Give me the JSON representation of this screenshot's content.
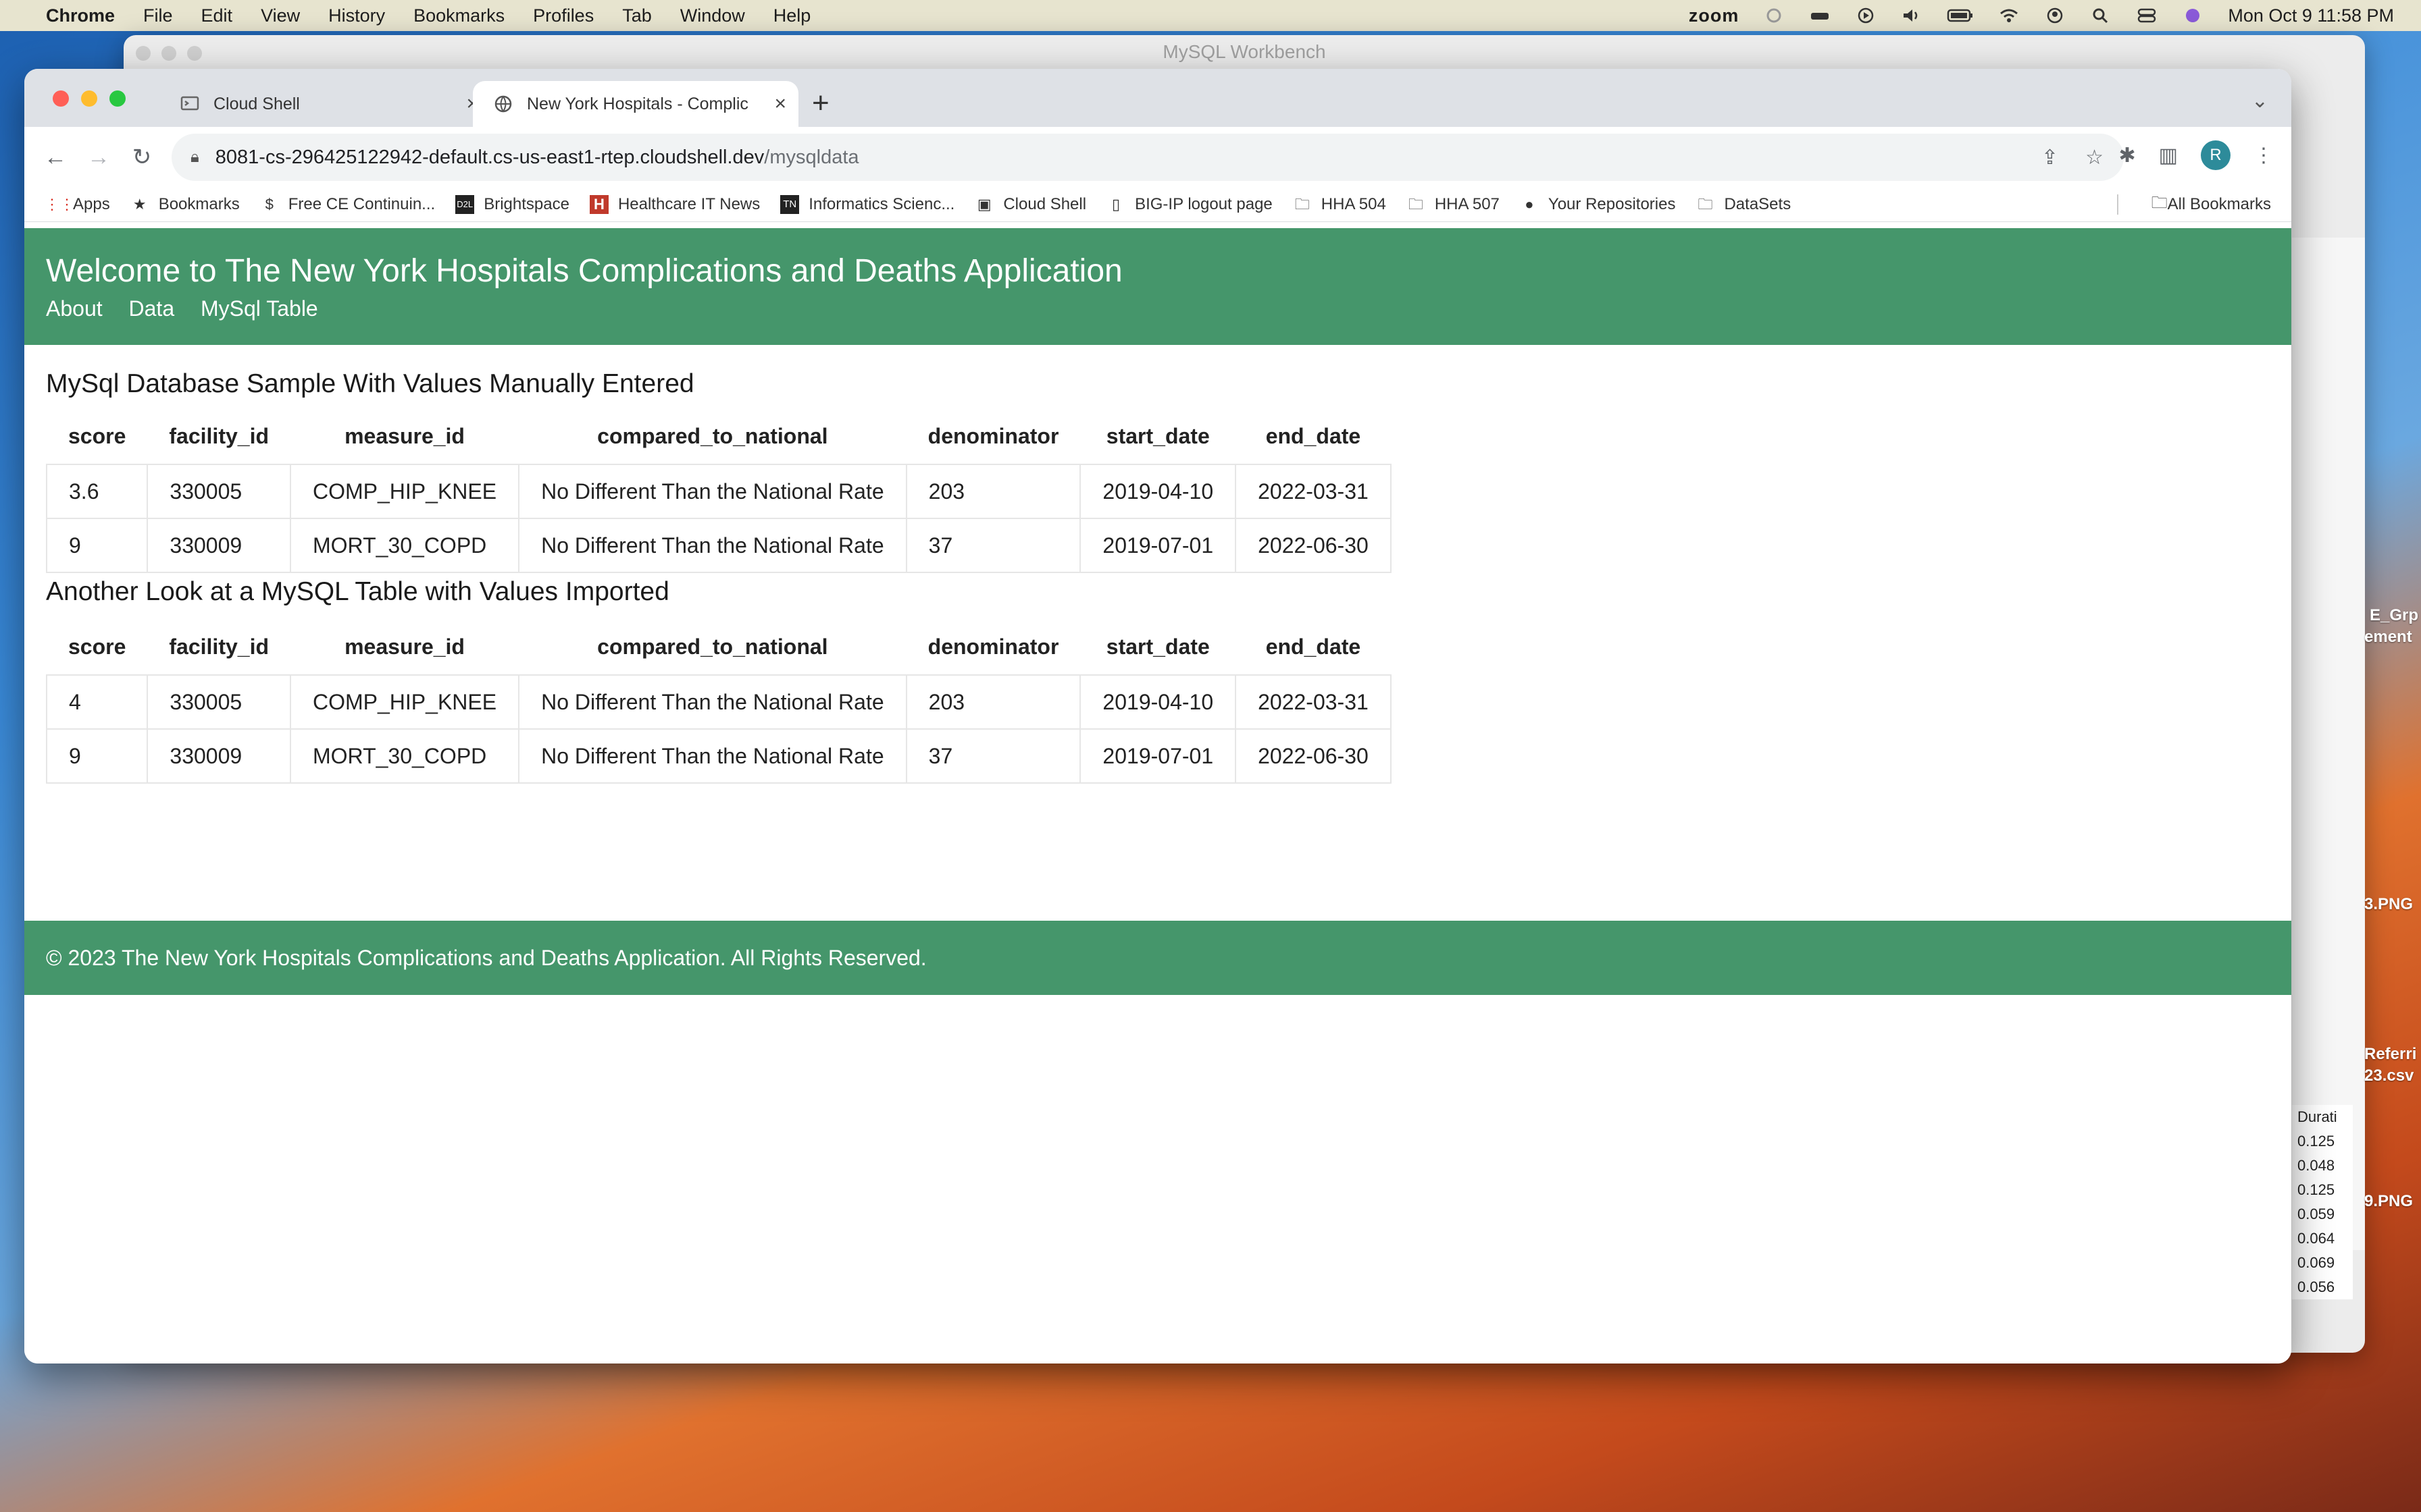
{
  "menubar": {
    "app": "Chrome",
    "items": [
      "File",
      "Edit",
      "View",
      "History",
      "Bookmarks",
      "Profiles",
      "Tab",
      "Window",
      "Help"
    ],
    "zoom_label": "zoom",
    "datetime": "Mon Oct 9  11:58 PM"
  },
  "bg_window": {
    "title": "MySQL Workbench",
    "duration_header": "Durati",
    "durations": [
      "0.125",
      "0.048",
      "0.125",
      "0.059",
      "0.064",
      "0.069",
      "0.056"
    ]
  },
  "desktop_labels": [
    "E_Grp",
    "ement",
    "3.PNG",
    "Referri",
    "23.csv",
    "9.PNG"
  ],
  "tabs": [
    {
      "label": "Cloud Shell"
    },
    {
      "label": "New York Hospitals - Complic"
    }
  ],
  "omnibox": {
    "host": "8081-cs-296425122942-default.cs-us-east1-rtep.cloudshell.dev",
    "path": "/mysqldata"
  },
  "profile_initial": "R",
  "bookmarks": [
    {
      "label": "Apps",
      "icon": "apps-grid-icon"
    },
    {
      "label": "Bookmarks",
      "icon": "star-icon"
    },
    {
      "label": "Free CE Continuin...",
      "icon": "dollar-icon"
    },
    {
      "label": "Brightspace",
      "icon": "d2l-icon"
    },
    {
      "label": "Healthcare IT News",
      "icon": "h-icon"
    },
    {
      "label": "Informatics Scienc...",
      "icon": "tn-icon"
    },
    {
      "label": "Cloud Shell",
      "icon": "cloudshell-icon"
    },
    {
      "label": "BIG-IP logout page",
      "icon": "page-icon"
    },
    {
      "label": "HHA 504",
      "icon": "folder-icon"
    },
    {
      "label": "HHA 507",
      "icon": "folder-icon"
    },
    {
      "label": "Your Repositories",
      "icon": "github-icon"
    },
    {
      "label": "DataSets",
      "icon": "folder-icon"
    }
  ],
  "all_bookmarks": "All Bookmarks",
  "page": {
    "title": "Welcome to The New York Hospitals Complications and Deaths Application",
    "nav": [
      "About",
      "Data",
      "MySql Table"
    ],
    "section1_title": "MySql Database Sample With Values Manually Entered",
    "section2_title": "Another Look at a MySQL Table with Values Imported",
    "columns": [
      "score",
      "facility_id",
      "measure_id",
      "compared_to_national",
      "denominator",
      "start_date",
      "end_date"
    ],
    "table1": [
      [
        "3.6",
        "330005",
        "COMP_HIP_KNEE",
        "No Different Than the National Rate",
        "203",
        "2019-04-10",
        "2022-03-31"
      ],
      [
        "9",
        "330009",
        "MORT_30_COPD",
        "No Different Than the National Rate",
        "37",
        "2019-07-01",
        "2022-06-30"
      ]
    ],
    "table2": [
      [
        "4",
        "330005",
        "COMP_HIP_KNEE",
        "No Different Than the National Rate",
        "203",
        "2019-04-10",
        "2022-03-31"
      ],
      [
        "9",
        "330009",
        "MORT_30_COPD",
        "No Different Than the National Rate",
        "37",
        "2019-07-01",
        "2022-06-30"
      ]
    ],
    "footer": "© 2023 The New York Hospitals Complications and Deaths Application. All Rights Reserved."
  },
  "colors": {
    "brand_green": "#45966b",
    "tab_strip": "#dee1e6"
  }
}
